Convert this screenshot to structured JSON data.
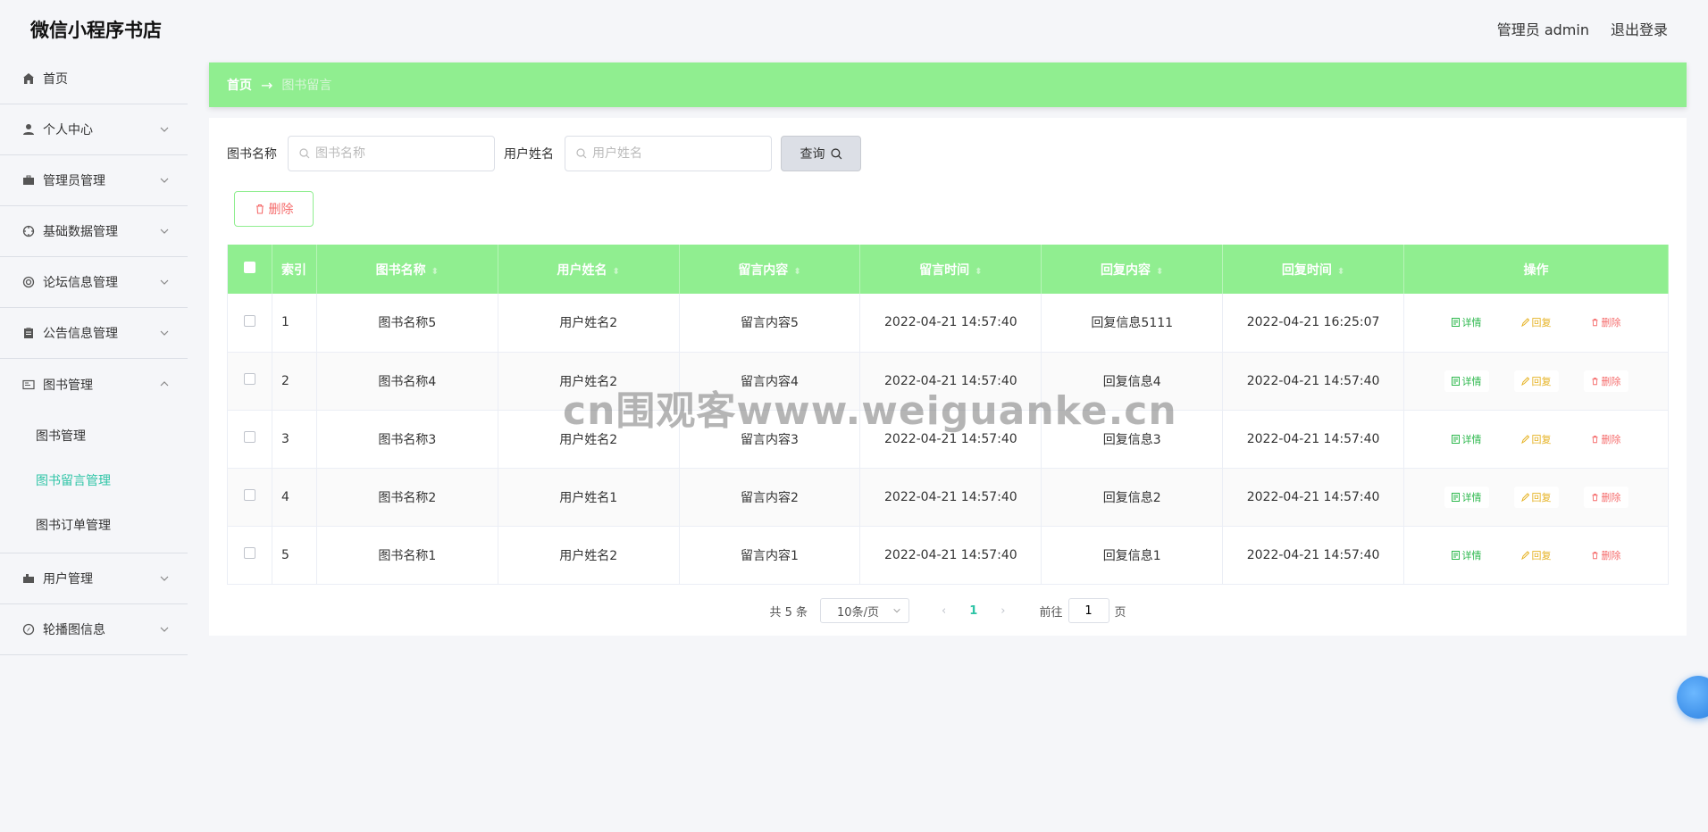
{
  "header": {
    "app_title": "微信小程序书店",
    "admin_label": "管理员 admin",
    "logout_label": "退出登录"
  },
  "sidebar": {
    "items": [
      {
        "label": "首页",
        "icon": "home-icon"
      },
      {
        "label": "个人中心",
        "icon": "user-icon"
      },
      {
        "label": "管理员管理",
        "icon": "briefcase-icon"
      },
      {
        "label": "基础数据管理",
        "icon": "target-icon"
      },
      {
        "label": "论坛信息管理",
        "icon": "lifebuoy-icon"
      },
      {
        "label": "公告信息管理",
        "icon": "clipboard-icon"
      },
      {
        "label": "图书管理",
        "icon": "book-icon"
      },
      {
        "label": "用户管理",
        "icon": "suitcase-icon"
      },
      {
        "label": "轮播图信息",
        "icon": "compass-icon"
      }
    ],
    "book_submenu": [
      {
        "label": "图书管理"
      },
      {
        "label": "图书留言管理"
      },
      {
        "label": "图书订单管理"
      }
    ]
  },
  "breadcrumb": {
    "home": "首页",
    "arrow": "→",
    "current": "图书留言"
  },
  "search": {
    "book_label": "图书名称",
    "book_placeholder": "图书名称",
    "user_label": "用户姓名",
    "user_placeholder": "用户姓名",
    "query_label": "查询"
  },
  "toolbar": {
    "delete_label": "删除"
  },
  "table": {
    "columns": [
      "索引",
      "图书名称",
      "用户姓名",
      "留言内容",
      "留言时间",
      "回复内容",
      "回复时间",
      "操作"
    ],
    "actions": {
      "detail": "详情",
      "reply": "回复",
      "remove": "删除"
    },
    "rows": [
      {
        "index": "1",
        "book": "图书名称5",
        "user": "用户姓名2",
        "content": "留言内容5",
        "time": "2022-04-21 14:57:40",
        "reply": "回复信息5111",
        "reply_time": "2022-04-21 16:25:07"
      },
      {
        "index": "2",
        "book": "图书名称4",
        "user": "用户姓名2",
        "content": "留言内容4",
        "time": "2022-04-21 14:57:40",
        "reply": "回复信息4",
        "reply_time": "2022-04-21 14:57:40"
      },
      {
        "index": "3",
        "book": "图书名称3",
        "user": "用户姓名2",
        "content": "留言内容3",
        "time": "2022-04-21 14:57:40",
        "reply": "回复信息3",
        "reply_time": "2022-04-21 14:57:40"
      },
      {
        "index": "4",
        "book": "图书名称2",
        "user": "用户姓名1",
        "content": "留言内容2",
        "time": "2022-04-21 14:57:40",
        "reply": "回复信息2",
        "reply_time": "2022-04-21 14:57:40"
      },
      {
        "index": "5",
        "book": "图书名称1",
        "user": "用户姓名2",
        "content": "留言内容1",
        "time": "2022-04-21 14:57:40",
        "reply": "回复信息1",
        "reply_time": "2022-04-21 14:57:40"
      }
    ]
  },
  "pagination": {
    "total": "共 5 条",
    "page_size": "10条/页",
    "current_page": "1",
    "goto_prefix": "前往",
    "goto_value": "1",
    "goto_suffix": "页"
  },
  "watermark": "cn围观客www.weiguanke.cn",
  "colors": {
    "accent_green": "#90ee90",
    "active_teal": "#2ec4a6",
    "danger": "#f56c6c",
    "warning": "#e6b325",
    "success": "#2db84d"
  }
}
